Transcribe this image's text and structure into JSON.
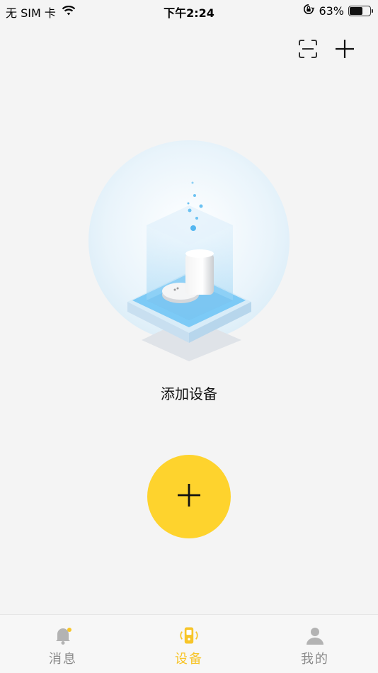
{
  "status_bar": {
    "carrier": "无 SIM 卡",
    "time": "下午2:24",
    "battery_percent": "63%",
    "battery_level": 0.63
  },
  "top_actions": [
    {
      "icon": "scan-icon"
    },
    {
      "icon": "plus-icon"
    }
  ],
  "main": {
    "add_device_label": "添加设备"
  },
  "tabs": [
    {
      "label": "消息",
      "icon": "bell-icon",
      "active": false
    },
    {
      "label": "设备",
      "icon": "device-icon",
      "active": true
    },
    {
      "label": "我的",
      "icon": "person-icon",
      "active": false
    }
  ],
  "colors": {
    "accent": "#fed32d",
    "active_tab": "#f7c52a",
    "inactive_tab": "#8a8a8a",
    "background": "#f4f4f4"
  }
}
